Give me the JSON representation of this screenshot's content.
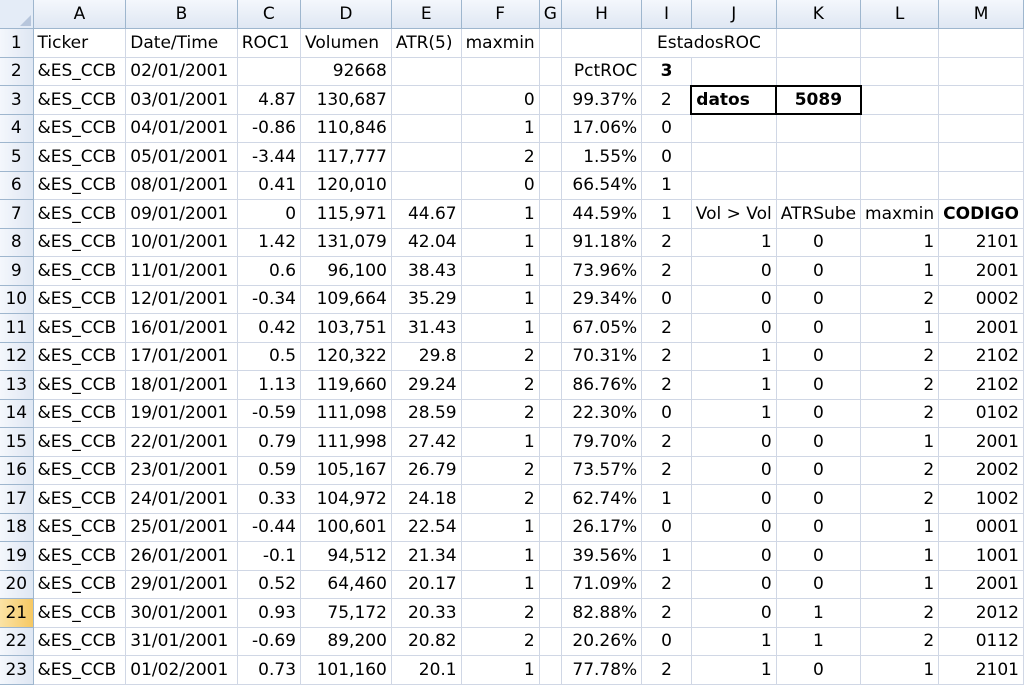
{
  "columns": [
    "A",
    "B",
    "C",
    "D",
    "E",
    "F",
    "G",
    "H",
    "I",
    "J",
    "K",
    "L",
    "M"
  ],
  "rows": [
    {
      "n": "1",
      "a": "Ticker",
      "b": "Date/Time",
      "c": "ROC1",
      "d": "Volumen",
      "e": "ATR(5)",
      "f": "maxmin",
      "g": "",
      "h": "",
      "i": "EstadosROC",
      "j": "",
      "k": "",
      "l": "",
      "m": ""
    },
    {
      "n": "2",
      "a": "&ES_CCB",
      "b": "02/01/2001",
      "c": "",
      "d": "92668",
      "e": "",
      "f": "",
      "g": "",
      "h": "PctROC",
      "i": "3",
      "j": "",
      "k": "",
      "l": "",
      "m": ""
    },
    {
      "n": "3",
      "a": "&ES_CCB",
      "b": "03/01/2001",
      "c": "4.87",
      "d": "130,687",
      "e": "",
      "f": "0",
      "g": "",
      "h": "99.37%",
      "i": "2",
      "j": "datos",
      "k": "5089",
      "l": "",
      "m": ""
    },
    {
      "n": "4",
      "a": "&ES_CCB",
      "b": "04/01/2001",
      "c": "-0.86",
      "d": "110,846",
      "e": "",
      "f": "1",
      "g": "",
      "h": "17.06%",
      "i": "0",
      "j": "",
      "k": "",
      "l": "",
      "m": ""
    },
    {
      "n": "5",
      "a": "&ES_CCB",
      "b": "05/01/2001",
      "c": "-3.44",
      "d": "117,777",
      "e": "",
      "f": "2",
      "g": "",
      "h": "1.55%",
      "i": "0",
      "j": "",
      "k": "",
      "l": "",
      "m": ""
    },
    {
      "n": "6",
      "a": "&ES_CCB",
      "b": "08/01/2001",
      "c": "0.41",
      "d": "120,010",
      "e": "",
      "f": "0",
      "g": "",
      "h": "66.54%",
      "i": "1",
      "j": "",
      "k": "",
      "l": "",
      "m": ""
    },
    {
      "n": "7",
      "a": "&ES_CCB",
      "b": "09/01/2001",
      "c": "0",
      "d": "115,971",
      "e": "44.67",
      "f": "1",
      "g": "",
      "h": "44.59%",
      "i": "1",
      "j": "Vol > Vol",
      "k": "ATRSube",
      "l": "maxmin",
      "m": "CODIGO"
    },
    {
      "n": "8",
      "a": "&ES_CCB",
      "b": "10/01/2001",
      "c": "1.42",
      "d": "131,079",
      "e": "42.04",
      "f": "1",
      "g": "",
      "h": "91.18%",
      "i": "2",
      "j": "1",
      "k": "0",
      "l": "1",
      "m": "2101"
    },
    {
      "n": "9",
      "a": "&ES_CCB",
      "b": "11/01/2001",
      "c": "0.6",
      "d": "96,100",
      "e": "38.43",
      "f": "1",
      "g": "",
      "h": "73.96%",
      "i": "2",
      "j": "0",
      "k": "0",
      "l": "1",
      "m": "2001"
    },
    {
      "n": "10",
      "a": "&ES_CCB",
      "b": "12/01/2001",
      "c": "-0.34",
      "d": "109,664",
      "e": "35.29",
      "f": "1",
      "g": "",
      "h": "29.34%",
      "i": "0",
      "j": "0",
      "k": "0",
      "l": "2",
      "m": "0002"
    },
    {
      "n": "11",
      "a": "&ES_CCB",
      "b": "16/01/2001",
      "c": "0.42",
      "d": "103,751",
      "e": "31.43",
      "f": "1",
      "g": "",
      "h": "67.05%",
      "i": "2",
      "j": "0",
      "k": "0",
      "l": "1",
      "m": "2001"
    },
    {
      "n": "12",
      "a": "&ES_CCB",
      "b": "17/01/2001",
      "c": "0.5",
      "d": "120,322",
      "e": "29.8",
      "f": "2",
      "g": "",
      "h": "70.31%",
      "i": "2",
      "j": "1",
      "k": "0",
      "l": "2",
      "m": "2102"
    },
    {
      "n": "13",
      "a": "&ES_CCB",
      "b": "18/01/2001",
      "c": "1.13",
      "d": "119,660",
      "e": "29.24",
      "f": "2",
      "g": "",
      "h": "86.76%",
      "i": "2",
      "j": "1",
      "k": "0",
      "l": "2",
      "m": "2102"
    },
    {
      "n": "14",
      "a": "&ES_CCB",
      "b": "19/01/2001",
      "c": "-0.59",
      "d": "111,098",
      "e": "28.59",
      "f": "2",
      "g": "",
      "h": "22.30%",
      "i": "0",
      "j": "1",
      "k": "0",
      "l": "2",
      "m": "0102"
    },
    {
      "n": "15",
      "a": "&ES_CCB",
      "b": "22/01/2001",
      "c": "0.79",
      "d": "111,998",
      "e": "27.42",
      "f": "1",
      "g": "",
      "h": "79.70%",
      "i": "2",
      "j": "0",
      "k": "0",
      "l": "1",
      "m": "2001"
    },
    {
      "n": "16",
      "a": "&ES_CCB",
      "b": "23/01/2001",
      "c": "0.59",
      "d": "105,167",
      "e": "26.79",
      "f": "2",
      "g": "",
      "h": "73.57%",
      "i": "2",
      "j": "0",
      "k": "0",
      "l": "2",
      "m": "2002"
    },
    {
      "n": "17",
      "a": "&ES_CCB",
      "b": "24/01/2001",
      "c": "0.33",
      "d": "104,972",
      "e": "24.18",
      "f": "2",
      "g": "",
      "h": "62.74%",
      "i": "1",
      "j": "0",
      "k": "0",
      "l": "2",
      "m": "1002"
    },
    {
      "n": "18",
      "a": "&ES_CCB",
      "b": "25/01/2001",
      "c": "-0.44",
      "d": "100,601",
      "e": "22.54",
      "f": "1",
      "g": "",
      "h": "26.17%",
      "i": "0",
      "j": "0",
      "k": "0",
      "l": "1",
      "m": "0001"
    },
    {
      "n": "19",
      "a": "&ES_CCB",
      "b": "26/01/2001",
      "c": "-0.1",
      "d": "94,512",
      "e": "21.34",
      "f": "1",
      "g": "",
      "h": "39.56%",
      "i": "1",
      "j": "0",
      "k": "0",
      "l": "1",
      "m": "1001"
    },
    {
      "n": "20",
      "a": "&ES_CCB",
      "b": "29/01/2001",
      "c": "0.52",
      "d": "64,460",
      "e": "20.17",
      "f": "1",
      "g": "",
      "h": "71.09%",
      "i": "2",
      "j": "0",
      "k": "0",
      "l": "1",
      "m": "2001"
    },
    {
      "n": "21",
      "a": "&ES_CCB",
      "b": "30/01/2001",
      "c": "0.93",
      "d": "75,172",
      "e": "20.33",
      "f": "2",
      "g": "",
      "h": "82.88%",
      "i": "2",
      "j": "0",
      "k": "1",
      "l": "2",
      "m": "2012"
    },
    {
      "n": "22",
      "a": "&ES_CCB",
      "b": "31/01/2001",
      "c": "-0.69",
      "d": "89,200",
      "e": "20.82",
      "f": "2",
      "g": "",
      "h": "20.26%",
      "i": "0",
      "j": "1",
      "k": "1",
      "l": "2",
      "m": "0112"
    },
    {
      "n": "23",
      "a": "&ES_CCB",
      "b": "01/02/2001",
      "c": "0.73",
      "d": "101,160",
      "e": "20.1",
      "f": "1",
      "g": "",
      "h": "77.78%",
      "i": "2",
      "j": "1",
      "k": "0",
      "l": "1",
      "m": "2101"
    }
  ]
}
